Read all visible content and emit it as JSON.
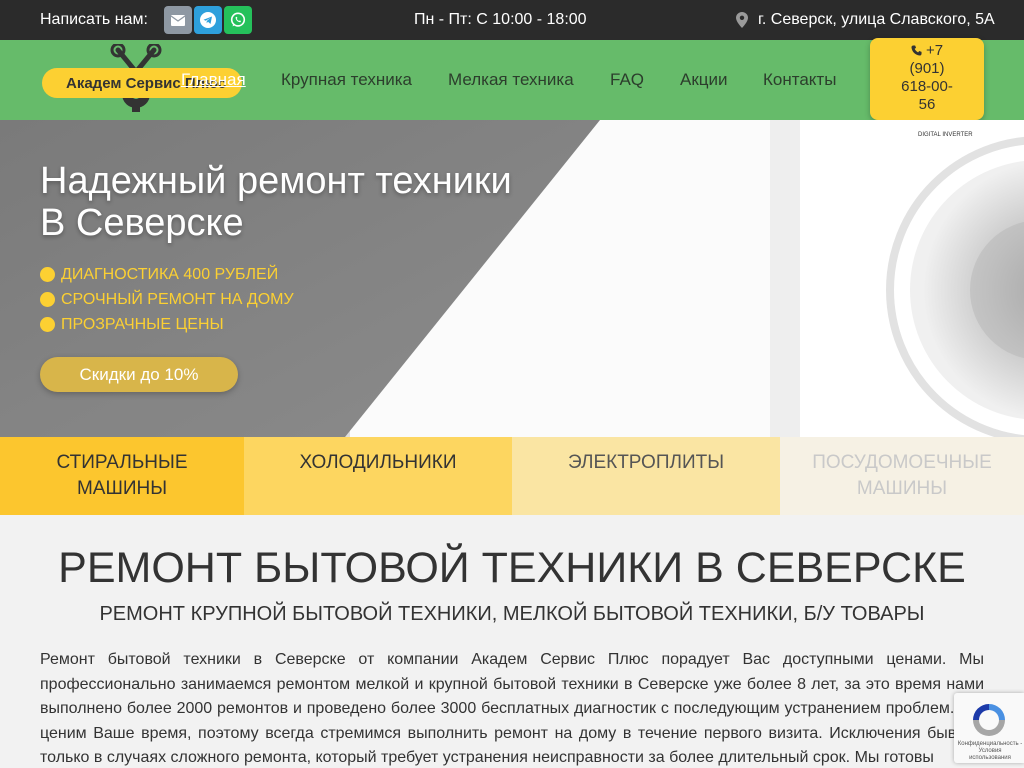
{
  "topbar": {
    "write_label": "Написать нам:",
    "messengers": [
      {
        "name": "email",
        "color": "#8e98a3"
      },
      {
        "name": "telegram",
        "color": "#2ea0dc"
      },
      {
        "name": "whatsapp",
        "color": "#25c15b"
      }
    ],
    "hours": "Пн - Пт: С 10:00 - 18:00",
    "address": "г. Северск, улица Славского, 5А"
  },
  "header": {
    "logo_text": "Академ Сервис Плюс",
    "nav": [
      "Главная",
      "Крупная техника",
      "Мелкая техника",
      "FAQ",
      "Акции",
      "Контакты"
    ],
    "active_nav": "Главная",
    "phone_lines": [
      "+7",
      "(901)",
      "618-00-",
      "56"
    ]
  },
  "hero": {
    "title_line1": "Надежный ремонт техники",
    "title_line2": "В Северске",
    "features": [
      "ДИАГНОСТИКА 400 РУБЛЕЙ",
      "СРОЧНЫЙ РЕМОНТ НА ДОМУ",
      "ПРОЗРАЧНЫЕ ЦЕНЫ"
    ],
    "button_label": "Скидки до 10%",
    "machine_label": "DIGITAL INVERTER"
  },
  "categories": [
    {
      "line1": "СТИРАЛЬНЫЕ",
      "line2": "МАШИНЫ"
    },
    {
      "line1": "ХОЛОДИЛЬНИКИ",
      "line2": ""
    },
    {
      "line1": "ЭЛЕКТРОПЛИТЫ",
      "line2": ""
    },
    {
      "line1": "ПОСУДОМОЕЧНЫЕ",
      "line2": "МАШИНЫ"
    }
  ],
  "content": {
    "heading": "РЕМОНТ БЫТОВОЙ ТЕХНИКИ В СЕВЕРСКЕ",
    "subheading": "РЕМОНТ КРУПНОЙ БЫТОВОЙ ТЕХНИКИ, МЕЛКОЙ БЫТОВОЙ ТЕХНИКИ, Б/У ТОВАРЫ",
    "paragraph": "Ремонт бытовой техники в Северске от компании Академ Сервис Плюс порадует Вас доступными ценами. Мы профессионально занимаемся ремонтом мелкой и крупной бытовой техники в Северске уже более 8 лет, за это время нами выполнено более 2000 ремонтов и проведено более 3000 бесплатных диагностик с последующим устранением проблем. Мы ценим Ваше время, поэтому всегда стремимся выполнить ремонт на дому в течение первого визита. Исключения бывают только в случаях сложного ремонта, который требует устранения неисправности за более длительный срок. Мы готовы"
  },
  "recaptcha": {
    "text": "Конфиденциальность - Условия использования"
  },
  "colors": {
    "accent_yellow": "#fcd032",
    "header_green": "#66bb6a",
    "topbar_dark": "#2b2b2b"
  }
}
